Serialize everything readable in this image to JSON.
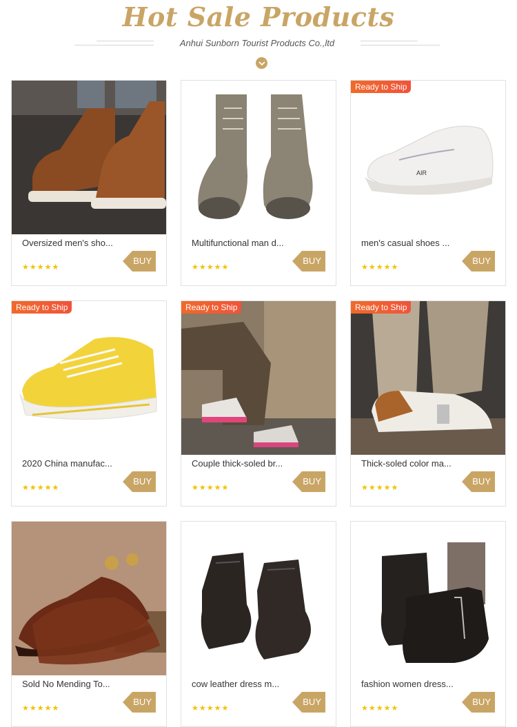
{
  "header": {
    "title": "Hot Sale Products",
    "subtitle": "Anhui Sunborn Tourist Products Co.,ltd"
  },
  "products": [
    {
      "name": "Oversized men's sho...",
      "badge": "",
      "buy": "BUY",
      "stars": "★★★★★",
      "image": "brown-leather-boots-image"
    },
    {
      "name": "Multifunctional man d...",
      "badge": "",
      "buy": "BUY",
      "stars": "★★★★★",
      "image": "suede-work-boots-image"
    },
    {
      "name": "men's casual shoes ...",
      "badge": "Ready to Ship",
      "buy": "BUY",
      "stars": "★★★★★",
      "image": "white-sneaker-image"
    },
    {
      "name": "2020 China manufac...",
      "badge": "Ready to Ship",
      "buy": "BUY",
      "stars": "★★★★★",
      "image": "yellow-canvas-shoe-image"
    },
    {
      "name": "Couple thick-soled br...",
      "badge": "Ready to Ship",
      "buy": "BUY",
      "stars": "★★★★★",
      "image": "couple-sneakers-image"
    },
    {
      "name": "Thick-soled color ma...",
      "badge": "Ready to Ship",
      "buy": "BUY",
      "stars": "★★★★★",
      "image": "white-brown-sneaker-image"
    },
    {
      "name": "Sold No Mending To...",
      "badge": "",
      "buy": "BUY",
      "stars": "★★★★★",
      "image": "brown-oxford-shoes-image"
    },
    {
      "name": "cow leather dress m...",
      "badge": "",
      "buy": "BUY",
      "stars": "★★★★★",
      "image": "black-dress-boots-image"
    },
    {
      "name": "fashion women dress...",
      "badge": "",
      "buy": "BUY",
      "stars": "★★★★★",
      "image": "black-ankle-boots-image"
    }
  ],
  "colors": {
    "accent": "#c9a565",
    "badge": "#f0533a",
    "star": "#f2c200"
  }
}
